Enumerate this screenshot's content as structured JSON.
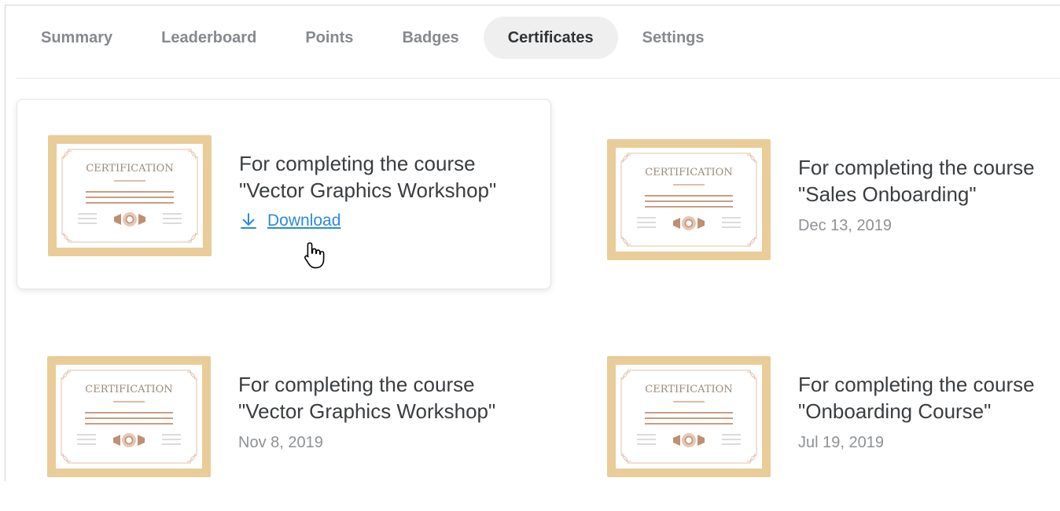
{
  "tabs": [
    {
      "label": "Summary"
    },
    {
      "label": "Leaderboard"
    },
    {
      "label": "Points"
    },
    {
      "label": "Badges"
    },
    {
      "label": "Certificates"
    },
    {
      "label": "Settings"
    }
  ],
  "active_tab": "Certificates",
  "certificates": [
    {
      "image_text": "CERTIFICATION",
      "line1": "For completing the course",
      "line2": "\"Vector Graphics Workshop\"",
      "action": "Download"
    },
    {
      "image_text": "CERTIFICATION",
      "line1": "For completing the course",
      "line2": "\"Sales Onboarding\"",
      "date": "Dec 13, 2019"
    },
    {
      "image_text": "CERTIFICATION",
      "line1": "For completing the course",
      "line2": "\"Vector Graphics Workshop\"",
      "date": "Nov 8, 2019"
    },
    {
      "image_text": "CERTIFICATION",
      "line1": "For completing the course",
      "line2": "\"Onboarding Course\"",
      "date": "Jul 19, 2019"
    }
  ],
  "colors": {
    "frame": "#e9cc98",
    "cert_text": "#9a8a7a",
    "accent_line": "#d9a58a",
    "link": "#2d8bd8"
  },
  "icons": {
    "download": "download-arrow-icon",
    "cursor": "hand-pointer-icon"
  }
}
